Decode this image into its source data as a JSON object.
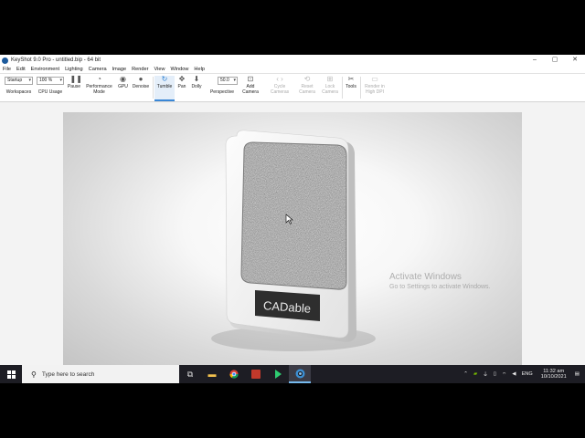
{
  "window": {
    "title": "KeyShot 9.0 Pro  -  untitled.bip  -  64 bit",
    "controls": {
      "minimize": "–",
      "maximize": "▢",
      "close": "✕"
    }
  },
  "menu": [
    "File",
    "Edit",
    "Environment",
    "Lighting",
    "Camera",
    "Image",
    "Render",
    "View",
    "Window",
    "Help"
  ],
  "toolbar": {
    "workspace_value": "Startup",
    "workspace_label": "Workspaces",
    "cpu_value": "100 %",
    "cpu_label": "CPU Usage",
    "pause": "Pause",
    "performance_line1": "Performance",
    "performance_line2": "Mode",
    "gpu": "GPU",
    "denoise": "Denoise",
    "tumble": "Tumble",
    "pan": "Pan",
    "dolly": "Dolly",
    "perspective_value": "50.0",
    "perspective_label": "Perspective",
    "add_camera_line1": "Add",
    "add_camera_line2": "Camera",
    "cycle_cameras_line1": "Cycle",
    "cycle_cameras_line2": "Cameras",
    "reset_camera_line1": "Reset",
    "reset_camera_line2": "Camera",
    "lock_camera_line1": "Lock",
    "lock_camera_line2": "Camera",
    "tools": "Tools",
    "render_hidpi_line1": "Render in",
    "render_hidpi_line2": "High DPI"
  },
  "viewport": {
    "product_label": "CADable"
  },
  "watermark": {
    "line1": "Activate Windows",
    "line2": "Go to Settings to activate Windows."
  },
  "taskbar": {
    "search_placeholder": "Type here to search",
    "language": "ENG",
    "time": "11:32 am",
    "date": "10/10/2021"
  }
}
